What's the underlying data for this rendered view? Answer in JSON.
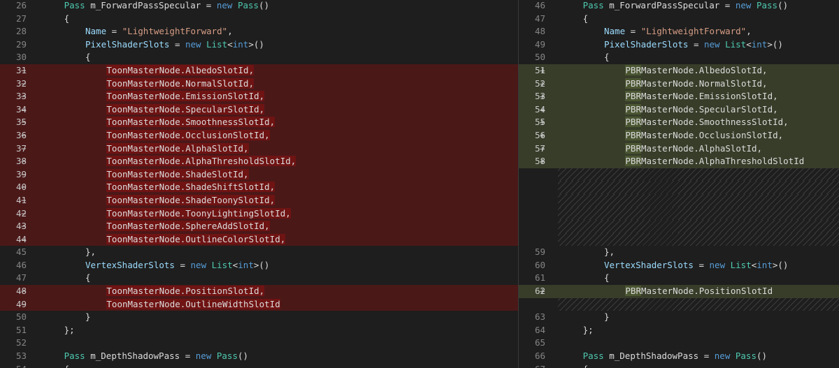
{
  "colors": {
    "background": "#1e1e1e",
    "deleted_line": "#4b1818",
    "added_line": "#373d29",
    "keyword": "#569cd6",
    "type": "#4ec9b0",
    "string": "#d69d85"
  },
  "left": {
    "lines": [
      {
        "n": "26",
        "m": "",
        "type": "ctx",
        "ind": 6,
        "tokens": [
          [
            "ty",
            "Pass"
          ],
          [
            "id",
            " m_ForwardPassSpecular "
          ],
          [
            "id",
            "= "
          ],
          [
            "kw",
            "new"
          ],
          [
            "id",
            " "
          ],
          [
            "ty",
            "Pass"
          ],
          [
            "id",
            "()"
          ]
        ]
      },
      {
        "n": "27",
        "m": "",
        "type": "ctx",
        "ind": 6,
        "tokens": [
          [
            "id",
            "{"
          ]
        ]
      },
      {
        "n": "28",
        "m": "",
        "type": "ctx",
        "ind": 10,
        "tokens": [
          [
            "idf",
            "Name"
          ],
          [
            "id",
            " = "
          ],
          [
            "str",
            "\"LightweightForward\""
          ],
          [
            "id",
            ","
          ]
        ]
      },
      {
        "n": "29",
        "m": "",
        "type": "ctx",
        "ind": 10,
        "tokens": [
          [
            "idf",
            "PixelShaderSlots"
          ],
          [
            "id",
            " = "
          ],
          [
            "kw",
            "new"
          ],
          [
            "id",
            " "
          ],
          [
            "ty",
            "List"
          ],
          [
            "id",
            "<"
          ],
          [
            "kw",
            "int"
          ],
          [
            "id",
            ">()"
          ]
        ]
      },
      {
        "n": "30",
        "m": "",
        "type": "ctx",
        "ind": 10,
        "tokens": [
          [
            "id",
            "{"
          ]
        ]
      },
      {
        "n": "31",
        "m": "−",
        "type": "del",
        "ind": 14,
        "tokens": [
          [
            "hl",
            "ToonMasterNode.AlbedoSlotId,"
          ]
        ]
      },
      {
        "n": "32",
        "m": "−",
        "type": "del",
        "ind": 14,
        "tokens": [
          [
            "hl",
            "ToonMasterNode.NormalSlotId,"
          ]
        ]
      },
      {
        "n": "33",
        "m": "−",
        "type": "del",
        "ind": 14,
        "tokens": [
          [
            "hl",
            "ToonMasterNode.EmissionSlotId,"
          ]
        ]
      },
      {
        "n": "34",
        "m": "−",
        "type": "del",
        "ind": 14,
        "tokens": [
          [
            "hl",
            "ToonMasterNode.SpecularSlotId,"
          ]
        ]
      },
      {
        "n": "35",
        "m": "−",
        "type": "del",
        "ind": 14,
        "tokens": [
          [
            "hl",
            "ToonMasterNode.SmoothnessSlotId,"
          ]
        ]
      },
      {
        "n": "36",
        "m": "−",
        "type": "del",
        "ind": 14,
        "tokens": [
          [
            "hl",
            "ToonMasterNode.OcclusionSlotId,"
          ]
        ]
      },
      {
        "n": "37",
        "m": "−",
        "type": "del",
        "ind": 14,
        "tokens": [
          [
            "hl",
            "ToonMasterNode.AlphaSlotId,"
          ]
        ]
      },
      {
        "n": "38",
        "m": "−",
        "type": "del",
        "ind": 14,
        "tokens": [
          [
            "hl",
            "ToonMasterNode.AlphaThresholdSlotId,"
          ]
        ]
      },
      {
        "n": "39",
        "m": "−",
        "type": "del",
        "ind": 14,
        "tokens": [
          [
            "hl",
            "ToonMasterNode.ShadeSlotId,"
          ]
        ]
      },
      {
        "n": "40",
        "m": "−",
        "type": "del",
        "ind": 14,
        "tokens": [
          [
            "hl",
            "ToonMasterNode.ShadeShiftSlotId,"
          ]
        ]
      },
      {
        "n": "41",
        "m": "−",
        "type": "del",
        "ind": 14,
        "tokens": [
          [
            "hl",
            "ToonMasterNode.ShadeToonySlotId,"
          ]
        ]
      },
      {
        "n": "42",
        "m": "−",
        "type": "del",
        "ind": 14,
        "tokens": [
          [
            "hl",
            "ToonMasterNode.ToonyLightingSlotId,"
          ]
        ]
      },
      {
        "n": "43",
        "m": "−",
        "type": "del",
        "ind": 14,
        "tokens": [
          [
            "hl",
            "ToonMasterNode.SphereAddSlotId,"
          ]
        ]
      },
      {
        "n": "44",
        "m": "−",
        "type": "del",
        "ind": 14,
        "tokens": [
          [
            "hl",
            "ToonMasterNode.OutlineColorSlotId,"
          ]
        ]
      },
      {
        "n": "45",
        "m": "",
        "type": "ctx",
        "ind": 10,
        "tokens": [
          [
            "id",
            "},"
          ]
        ]
      },
      {
        "n": "46",
        "m": "",
        "type": "ctx",
        "ind": 10,
        "tokens": [
          [
            "idf",
            "VertexShaderSlots"
          ],
          [
            "id",
            " = "
          ],
          [
            "kw",
            "new"
          ],
          [
            "id",
            " "
          ],
          [
            "ty",
            "List"
          ],
          [
            "id",
            "<"
          ],
          [
            "kw",
            "int"
          ],
          [
            "id",
            ">()"
          ]
        ]
      },
      {
        "n": "47",
        "m": "",
        "type": "ctx",
        "ind": 10,
        "tokens": [
          [
            "id",
            "{"
          ]
        ]
      },
      {
        "n": "48",
        "m": "−",
        "type": "del",
        "ind": 14,
        "tokens": [
          [
            "hl",
            "ToonMasterNode.PositionSlotId,"
          ]
        ]
      },
      {
        "n": "49",
        "m": "−",
        "type": "del",
        "ind": 14,
        "tokens": [
          [
            "hl",
            "ToonMasterNode.OutlineWidthSlotId"
          ]
        ]
      },
      {
        "n": "50",
        "m": "",
        "type": "ctx",
        "ind": 10,
        "tokens": [
          [
            "id",
            "}"
          ]
        ]
      },
      {
        "n": "51",
        "m": "",
        "type": "ctx",
        "ind": 6,
        "tokens": [
          [
            "id",
            "};"
          ]
        ]
      },
      {
        "n": "52",
        "m": "",
        "type": "ctx",
        "ind": 0,
        "tokens": []
      },
      {
        "n": "53",
        "m": "",
        "type": "ctx",
        "ind": 6,
        "tokens": [
          [
            "ty",
            "Pass"
          ],
          [
            "id",
            " m_DepthShadowPass "
          ],
          [
            "id",
            "= "
          ],
          [
            "kw",
            "new"
          ],
          [
            "id",
            " "
          ],
          [
            "ty",
            "Pass"
          ],
          [
            "id",
            "()"
          ]
        ]
      },
      {
        "n": "54",
        "m": "",
        "type": "ctx",
        "ind": 6,
        "tokens": [
          [
            "id",
            "{"
          ]
        ]
      }
    ]
  },
  "right": {
    "lines": [
      {
        "n": "46",
        "m": "",
        "type": "ctx",
        "ind": 6,
        "tokens": [
          [
            "ty",
            "Pass"
          ],
          [
            "id",
            " m_ForwardPassSpecular "
          ],
          [
            "id",
            "= "
          ],
          [
            "kw",
            "new"
          ],
          [
            "id",
            " "
          ],
          [
            "ty",
            "Pass"
          ],
          [
            "id",
            "()"
          ]
        ]
      },
      {
        "n": "47",
        "m": "",
        "type": "ctx",
        "ind": 6,
        "tokens": [
          [
            "id",
            "{"
          ]
        ]
      },
      {
        "n": "48",
        "m": "",
        "type": "ctx",
        "ind": 10,
        "tokens": [
          [
            "idf",
            "Name"
          ],
          [
            "id",
            " = "
          ],
          [
            "str",
            "\"LightweightForward\""
          ],
          [
            "id",
            ","
          ]
        ]
      },
      {
        "n": "49",
        "m": "",
        "type": "ctx",
        "ind": 10,
        "tokens": [
          [
            "idf",
            "PixelShaderSlots"
          ],
          [
            "id",
            " = "
          ],
          [
            "kw",
            "new"
          ],
          [
            "id",
            " "
          ],
          [
            "ty",
            "List"
          ],
          [
            "id",
            "<"
          ],
          [
            "kw",
            "int"
          ],
          [
            "id",
            ">()"
          ]
        ]
      },
      {
        "n": "50",
        "m": "",
        "type": "ctx",
        "ind": 10,
        "tokens": [
          [
            "id",
            "{"
          ]
        ]
      },
      {
        "n": "51",
        "m": "+",
        "type": "add",
        "ind": 14,
        "tokens": [
          [
            "hl",
            "PBR"
          ],
          [
            "id",
            "MasterNode.AlbedoSlotId,"
          ]
        ]
      },
      {
        "n": "52",
        "m": "+",
        "type": "add",
        "ind": 14,
        "tokens": [
          [
            "hl",
            "PBR"
          ],
          [
            "id",
            "MasterNode.NormalSlotId,"
          ]
        ]
      },
      {
        "n": "53",
        "m": "+",
        "type": "add",
        "ind": 14,
        "tokens": [
          [
            "hl",
            "PBR"
          ],
          [
            "id",
            "MasterNode.EmissionSlotId,"
          ]
        ]
      },
      {
        "n": "54",
        "m": "+",
        "type": "add",
        "ind": 14,
        "tokens": [
          [
            "hl",
            "PBR"
          ],
          [
            "id",
            "MasterNode.SpecularSlotId,"
          ]
        ]
      },
      {
        "n": "55",
        "m": "+",
        "type": "add",
        "ind": 14,
        "tokens": [
          [
            "hl",
            "PBR"
          ],
          [
            "id",
            "MasterNode.SmoothnessSlotId,"
          ]
        ]
      },
      {
        "n": "56",
        "m": "+",
        "type": "add",
        "ind": 14,
        "tokens": [
          [
            "hl",
            "PBR"
          ],
          [
            "id",
            "MasterNode.OcclusionSlotId,"
          ]
        ]
      },
      {
        "n": "57",
        "m": "+",
        "type": "add",
        "ind": 14,
        "tokens": [
          [
            "hl",
            "PBR"
          ],
          [
            "id",
            "MasterNode.AlphaSlotId,"
          ]
        ]
      },
      {
        "n": "58",
        "m": "+",
        "type": "add",
        "ind": 14,
        "tokens": [
          [
            "hl",
            "PBR"
          ],
          [
            "id",
            "MasterNode.AlphaThresholdSlotId"
          ]
        ]
      },
      {
        "n": "",
        "m": "",
        "type": "filler",
        "ind": 0,
        "tokens": []
      },
      {
        "n": "",
        "m": "",
        "type": "filler",
        "ind": 0,
        "tokens": []
      },
      {
        "n": "",
        "m": "",
        "type": "filler",
        "ind": 0,
        "tokens": []
      },
      {
        "n": "",
        "m": "",
        "type": "filler",
        "ind": 0,
        "tokens": []
      },
      {
        "n": "",
        "m": "",
        "type": "filler",
        "ind": 0,
        "tokens": []
      },
      {
        "n": "",
        "m": "",
        "type": "filler",
        "ind": 0,
        "tokens": []
      },
      {
        "n": "59",
        "m": "",
        "type": "ctx",
        "ind": 10,
        "tokens": [
          [
            "id",
            "},"
          ]
        ]
      },
      {
        "n": "60",
        "m": "",
        "type": "ctx",
        "ind": 10,
        "tokens": [
          [
            "idf",
            "VertexShaderSlots"
          ],
          [
            "id",
            " = "
          ],
          [
            "kw",
            "new"
          ],
          [
            "id",
            " "
          ],
          [
            "ty",
            "List"
          ],
          [
            "id",
            "<"
          ],
          [
            "kw",
            "int"
          ],
          [
            "id",
            ">()"
          ]
        ]
      },
      {
        "n": "61",
        "m": "",
        "type": "ctx",
        "ind": 10,
        "tokens": [
          [
            "id",
            "{"
          ]
        ]
      },
      {
        "n": "62",
        "m": "+",
        "type": "add",
        "ind": 14,
        "tokens": [
          [
            "hl",
            "PBR"
          ],
          [
            "id",
            "MasterNode.PositionSlotId"
          ]
        ]
      },
      {
        "n": "",
        "m": "",
        "type": "filler",
        "ind": 0,
        "tokens": []
      },
      {
        "n": "63",
        "m": "",
        "type": "ctx",
        "ind": 10,
        "tokens": [
          [
            "id",
            "}"
          ]
        ]
      },
      {
        "n": "64",
        "m": "",
        "type": "ctx",
        "ind": 6,
        "tokens": [
          [
            "id",
            "};"
          ]
        ]
      },
      {
        "n": "65",
        "m": "",
        "type": "ctx",
        "ind": 0,
        "tokens": []
      },
      {
        "n": "66",
        "m": "",
        "type": "ctx",
        "ind": 6,
        "tokens": [
          [
            "ty",
            "Pass"
          ],
          [
            "id",
            " m_DepthShadowPass "
          ],
          [
            "id",
            "= "
          ],
          [
            "kw",
            "new"
          ],
          [
            "id",
            " "
          ],
          [
            "ty",
            "Pass"
          ],
          [
            "id",
            "()"
          ]
        ]
      },
      {
        "n": "67",
        "m": "",
        "type": "ctx",
        "ind": 6,
        "tokens": [
          [
            "id",
            "{"
          ]
        ]
      }
    ]
  }
}
